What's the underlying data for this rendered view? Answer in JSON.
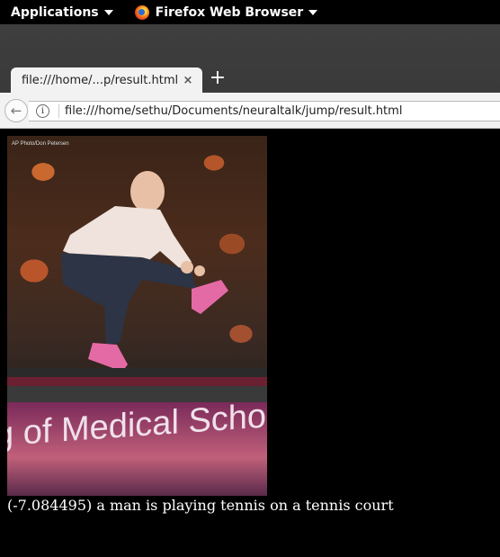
{
  "topbar": {
    "applications_label": "Applications",
    "browser_label": "Firefox Web Browser"
  },
  "tabs": [
    {
      "title": "file:///home/...p/result.html",
      "close": "×"
    }
  ],
  "newtab_label": "+",
  "navbar": {
    "url": "file:///home/sethu/Documents/neuraltalk/jump/result.html",
    "info_glyph": "i",
    "back_glyph": "←"
  },
  "content": {
    "photo_credit": "AP Photo/Don Petersen",
    "photo_sign_text": "g of Medical School",
    "caption": "(-7.084495) a man is playing tennis on a tennis court"
  }
}
